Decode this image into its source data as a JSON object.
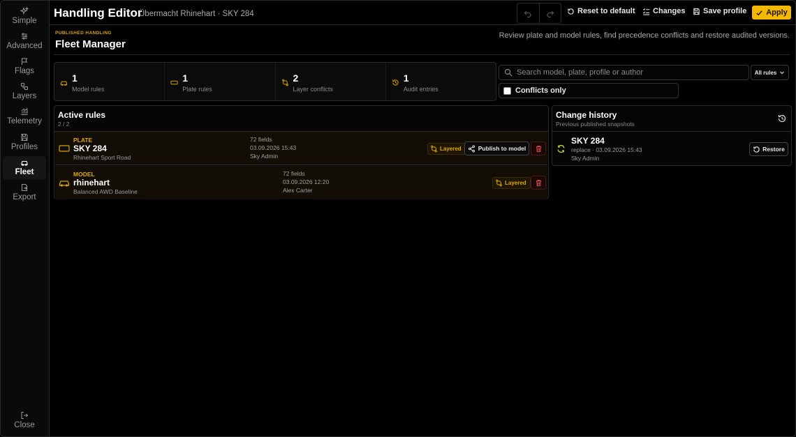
{
  "sidebar": {
    "items": [
      {
        "label": "Simple",
        "icon": "sparkles-icon"
      },
      {
        "label": "Advanced",
        "icon": "sliders-icon"
      },
      {
        "label": "Flags",
        "icon": "flag-icon"
      },
      {
        "label": "Layers",
        "icon": "layers-icon"
      },
      {
        "label": "Telemetry",
        "icon": "telemetry-icon"
      },
      {
        "label": "Profiles",
        "icon": "save-icon"
      },
      {
        "label": "Fleet",
        "icon": "car-icon"
      },
      {
        "label": "Export",
        "icon": "export-icon"
      }
    ],
    "active": "Fleet",
    "close_label": "Close"
  },
  "header": {
    "title": "Handling Editor",
    "subtitle": "Übermacht Rhinehart · SKY 284",
    "reset_label": "Reset to default",
    "changes_label": "Changes",
    "save_label": "Save profile",
    "apply_label": "Apply"
  },
  "page": {
    "eyebrow": "PUBLISHED HANDLING",
    "title": "Fleet Manager",
    "description": "Review plate and model rules, find precedence conflicts and restore audited versions."
  },
  "stats": [
    {
      "value": "1",
      "label": "Model rules",
      "icon": "car-icon"
    },
    {
      "value": "1",
      "label": "Plate rules",
      "icon": "plate-icon"
    },
    {
      "value": "2",
      "label": "Layer conflicts",
      "icon": "conflict-icon"
    },
    {
      "value": "1",
      "label": "Audit entries",
      "icon": "history-icon"
    }
  ],
  "search": {
    "placeholder": "Search model, plate, profile or author",
    "value": "",
    "filter_value": "All rules",
    "conflicts_only_label": "Conflicts only",
    "conflicts_only_checked": false
  },
  "rules_panel": {
    "title": "Active rules",
    "count": "2 / 2",
    "rows": [
      {
        "kind": "PLATE",
        "name": "SKY 284",
        "description": "Rhinehart Sport Road",
        "fields": "72 fields",
        "date": "03.09.2026 15:43",
        "author": "Sky Admin",
        "badge": "Layered",
        "publish_label": "Publish to model"
      },
      {
        "kind": "MODEL",
        "name": "rhinehart",
        "description": "Balanced AWD Baseline",
        "fields": "72 fields",
        "date": "03.09.2026 12:20",
        "author": "Alex Carter",
        "badge": "Layered"
      }
    ]
  },
  "history_panel": {
    "title": "Change history",
    "subtitle": "Previous published snapshots",
    "entries": [
      {
        "name": "SKY 284",
        "detail": "replace · 03.09.2026 15:43",
        "author": "Sky Admin",
        "restore_label": "Restore"
      }
    ]
  },
  "colors": {
    "accent": "#f5b800",
    "background": "#000000",
    "panel_border": "#2a2a2a",
    "danger": "#e05050",
    "history_icon": "#b9d830"
  }
}
